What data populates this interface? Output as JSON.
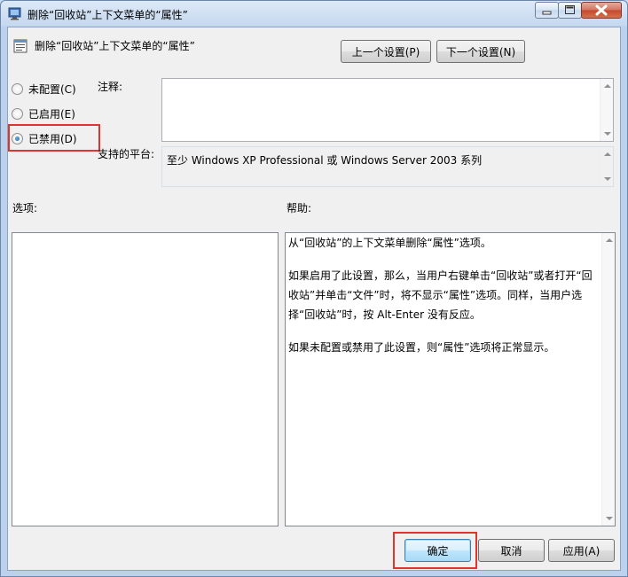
{
  "window": {
    "title": "删除“回收站”上下文菜单的“属性”",
    "buttons": {
      "minimize": "minimize",
      "maximize": "maximize",
      "close": "close"
    }
  },
  "header": {
    "title": "删除“回收站”上下文菜单的“属性”",
    "prev_button": "上一个设置(P)",
    "next_button": "下一个设置(N)"
  },
  "state": {
    "options": [
      {
        "label": "未配置(C)",
        "selected": false
      },
      {
        "label": "已启用(E)",
        "selected": false
      },
      {
        "label": "已禁用(D)",
        "selected": true
      }
    ]
  },
  "comment": {
    "label": "注释:",
    "value": ""
  },
  "platform": {
    "label": "支持的平台:",
    "value": "至少 Windows XP Professional 或 Windows Server 2003 系列"
  },
  "options_label": "选项:",
  "help": {
    "label": "帮助:",
    "paragraphs": [
      "从“回收站”的上下文菜单删除“属性”选项。",
      "如果启用了此设置，那么，当用户右键单击“回收站”或者打开“回收站”并单击“文件”时，将不显示“属性”选项。同样，当用户选择“回收站”时，按 Alt-Enter 没有反应。",
      "如果未配置或禁用了此设置，则“属性”选项将正常显示。"
    ]
  },
  "footer": {
    "ok": "确定",
    "cancel": "取消",
    "apply": "应用(A)"
  },
  "colors": {
    "highlight": "#e0352e",
    "accent": "#3c7fb1"
  }
}
